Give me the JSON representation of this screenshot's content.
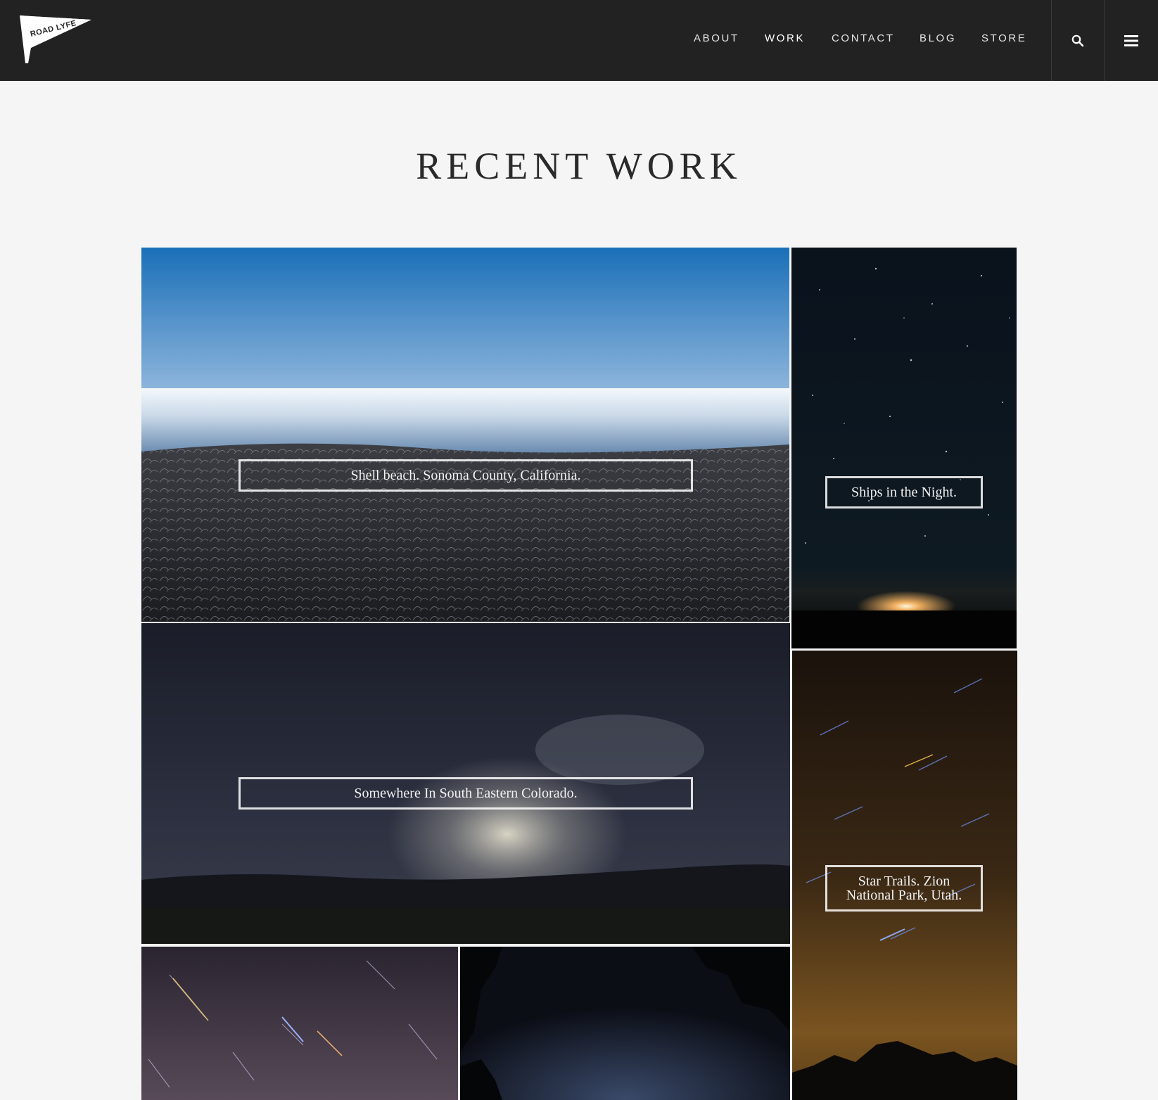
{
  "header": {
    "logo_text": "ROAD LYFE",
    "nav": [
      {
        "label": "ABOUT"
      },
      {
        "label": "WORK"
      },
      {
        "label": "CONTACT"
      },
      {
        "label": "BLOG"
      },
      {
        "label": "STORE"
      }
    ],
    "search_icon": "search-icon",
    "menu_icon": "hamburger-menu-icon"
  },
  "main": {
    "title": "RECENT WORK",
    "gallery": [
      {
        "caption": "Shell beach. Sonoma County, California."
      },
      {
        "caption": "Ships in the Night."
      },
      {
        "caption": "Somewhere In South Eastern Colorado."
      },
      {
        "caption": "Star Trails. Zion National Park, Utah."
      }
    ]
  },
  "colors": {
    "header_bg": "#222222",
    "page_bg": "#f5f5f5"
  }
}
